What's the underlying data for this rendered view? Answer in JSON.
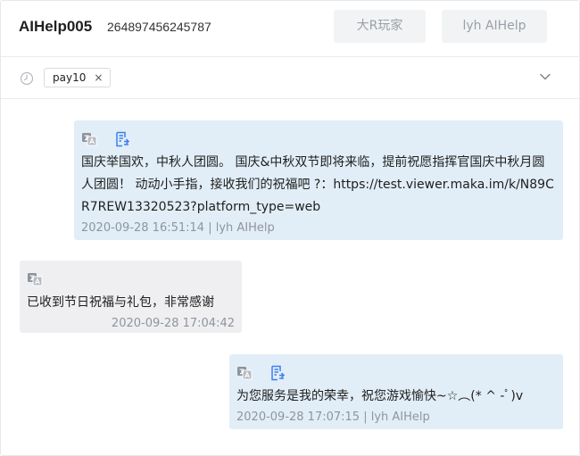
{
  "header": {
    "user_name": "AIHelp005",
    "user_id": "264897456245787",
    "buttons": [
      {
        "label": "大R玩家"
      },
      {
        "label": "lyh AIHelp"
      }
    ]
  },
  "filter": {
    "tag_label": "pay10",
    "tag_close": "×"
  },
  "messages": [
    {
      "side": "right",
      "icons": [
        "translate-icon",
        "document-icon"
      ],
      "text": "国庆举国欢，中秋人团圆。 国庆&中秋双节即将来临，提前祝愿指挥官国庆中秋月圆人团圆！ 动动小手指，接收我们的祝福吧 ?：https://test.viewer.maka.im/k/N89CR7REW13320523?platform_type=web",
      "meta": "2020-09-28 16:51:14 | lyh AIHelp"
    },
    {
      "side": "left",
      "icons": [
        "translate-icon"
      ],
      "text": "已收到节日祝福与礼包，非常感谢",
      "meta": "2020-09-28 17:04:42"
    },
    {
      "side": "right",
      "icons": [
        "translate-icon",
        "document-icon"
      ],
      "text": "为您服务是我的荣幸，祝您游戏愉快~☆︵(* ^ -ﾟ)v",
      "meta": "2020-09-28 17:07:15 | lyh AIHelp"
    }
  ],
  "colors": {
    "agent_bubble": "#e2eef7",
    "user_bubble": "#efeff1",
    "icon_blue": "#3d7ef0"
  }
}
